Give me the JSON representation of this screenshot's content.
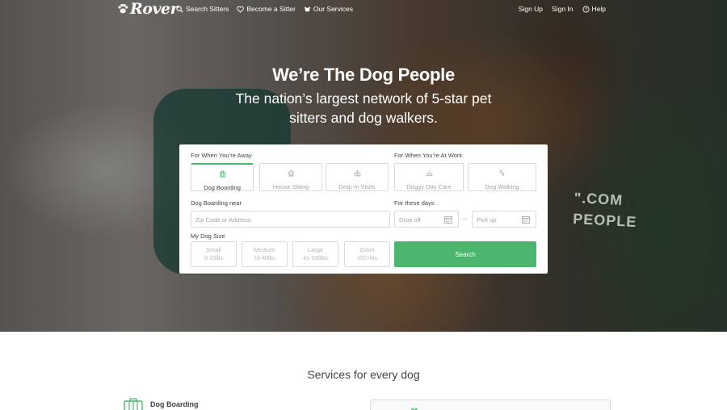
{
  "nav": {
    "brand": "Rover",
    "links": [
      {
        "label": "Search Sitters",
        "icon": "search-icon"
      },
      {
        "label": "Become a Sitter",
        "icon": "heart-icon"
      },
      {
        "label": "Our Services",
        "icon": "dog-icon"
      }
    ],
    "right_links": [
      {
        "label": "Sign Up"
      },
      {
        "label": "Sign In"
      },
      {
        "label": "Help",
        "icon": "help-icon"
      }
    ]
  },
  "hero": {
    "headline": "We’re The Dog People",
    "subheadline_line1": "The nation’s largest network of 5-star pet",
    "subheadline_line2": "sitters and dog walkers.",
    "shirt_text_line1": "\".COM",
    "shirt_text_line2": "PEOPLE"
  },
  "search": {
    "away_label": "For When You’re Away",
    "work_label": "For When You’re At Work",
    "services": [
      {
        "label": "Dog Boarding",
        "icon": "suitcase-icon",
        "selected": true
      },
      {
        "label": "House Sitting",
        "icon": "house-icon",
        "selected": false
      },
      {
        "label": "Drop-In Visits",
        "icon": "drop-in-icon",
        "selected": false
      },
      {
        "label": "Doggy Day Care",
        "icon": "sun-icon",
        "selected": false
      },
      {
        "label": "Dog Walking",
        "icon": "paw-prints-icon",
        "selected": false
      }
    ],
    "near_label": "Dog Boarding near",
    "location_placeholder": "Zip Code or Address",
    "days_label": "For these days",
    "dropoff_placeholder": "Drop off",
    "pickup_placeholder": "Pick up",
    "arrow": "→",
    "size_label": "My Dog Size",
    "sizes": [
      {
        "name": "Small",
        "range": "0-15lbs"
      },
      {
        "name": "Medium",
        "range": "16-40lbs"
      },
      {
        "name": "Large",
        "range": "41-100lbs"
      },
      {
        "name": "Giant",
        "range": "101+lbs"
      }
    ],
    "search_button": "Search"
  },
  "services_section": {
    "title": "Services for every dog",
    "first_service": "Dog Boarding"
  },
  "colors": {
    "accent": "#4bb56e",
    "text": "#404347",
    "border": "#d7dce0",
    "muted": "#9ea4ab"
  }
}
